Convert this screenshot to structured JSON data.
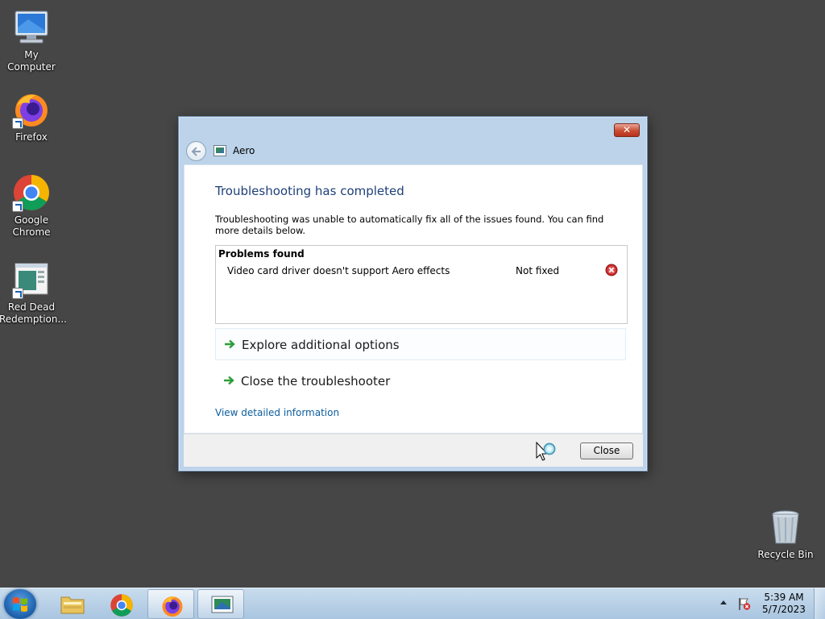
{
  "desktop": {
    "icons": [
      {
        "label": "My Computer"
      },
      {
        "label": "Firefox"
      },
      {
        "label": "Google Chrome"
      },
      {
        "label": "Red Dead Redemption..."
      },
      {
        "label": "Recycle Bin"
      }
    ]
  },
  "window": {
    "close_glyph": "✕",
    "app_title": "Aero",
    "heading": "Troubleshooting has completed",
    "description": "Troubleshooting was unable to automatically fix all of the issues found. You can find more details below.",
    "problems": {
      "title": "Problems found",
      "items": [
        {
          "name": "Video card driver doesn't support Aero effects",
          "status": "Not fixed",
          "status_icon": "error-icon"
        }
      ]
    },
    "options": [
      {
        "label": "Explore additional options"
      },
      {
        "label": "Close the troubleshooter"
      }
    ],
    "details_link": "View detailed information",
    "close_button": "Close"
  },
  "taskbar": {
    "items": [
      "windows-explorer",
      "google-chrome",
      "firefox",
      "aero-troubleshooter"
    ],
    "clock": {
      "time": "5:39 AM",
      "date": "5/7/2023"
    }
  },
  "colors": {
    "desktop": "#464646",
    "heading": "#1e3f78",
    "link": "#0c5d9c",
    "option_arrow": "#2e9e3a",
    "error": "#c62828"
  }
}
